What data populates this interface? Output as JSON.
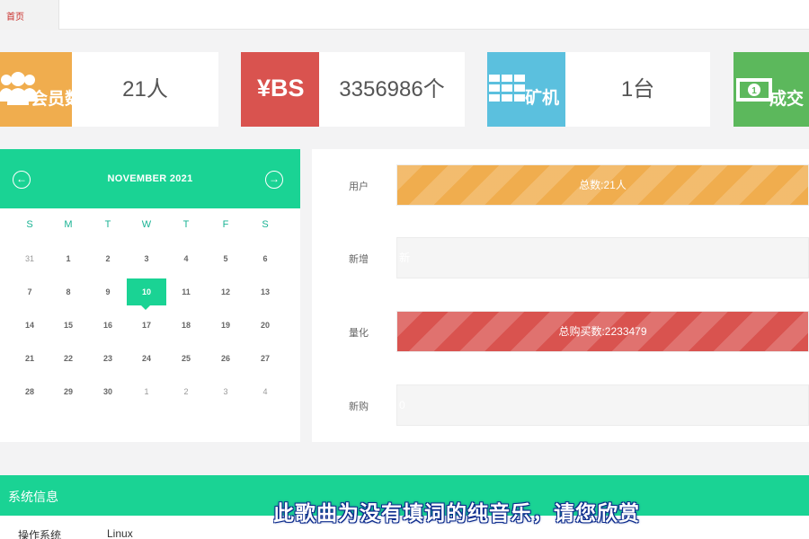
{
  "tabs": {
    "home": "首页"
  },
  "stats": [
    {
      "icon": "users-icon",
      "label": "会员数",
      "value": "21人",
      "color": "#f0ad4e"
    },
    {
      "icon": "yen-bs-icon",
      "label": "¥BS",
      "value": "3356986个",
      "color": "#d9534f"
    },
    {
      "icon": "grid-icon",
      "label": "矿机",
      "value": "1台",
      "color": "#5bc0de"
    },
    {
      "icon": "money-icon",
      "label": "成交",
      "value": "",
      "color": "#5cb85c"
    }
  ],
  "calendar": {
    "title": "NOVEMBER 2021",
    "prev": "←",
    "next": "→",
    "weekdays": [
      "S",
      "M",
      "T",
      "W",
      "T",
      "F",
      "S"
    ],
    "weeks": [
      [
        "31",
        "1",
        "2",
        "3",
        "4",
        "5",
        "6"
      ],
      [
        "7",
        "8",
        "9",
        "10",
        "11",
        "12",
        "13"
      ],
      [
        "14",
        "15",
        "16",
        "17",
        "18",
        "19",
        "20"
      ],
      [
        "21",
        "22",
        "23",
        "24",
        "25",
        "26",
        "27"
      ],
      [
        "28",
        "29",
        "30",
        "1",
        "2",
        "3",
        "4"
      ]
    ],
    "today": "10",
    "accent": "#1ad394"
  },
  "progress": [
    {
      "label": "用户",
      "text": "总数:21人",
      "fill": 1.0,
      "color": "#f0ad4e"
    },
    {
      "label": "新增",
      "text": "新",
      "fill": 0,
      "color": ""
    },
    {
      "label": "量化",
      "text": "总购买数:2233479",
      "fill": 1.0,
      "color": "#d9534f"
    },
    {
      "label": "新购",
      "text": "0",
      "fill": 0,
      "color": ""
    }
  ],
  "system": {
    "title": "系统信息",
    "rows": [
      {
        "key": "操作系统",
        "value": "Linux"
      }
    ]
  },
  "subtitle": "此歌曲为没有填词的纯音乐，请您欣赏"
}
